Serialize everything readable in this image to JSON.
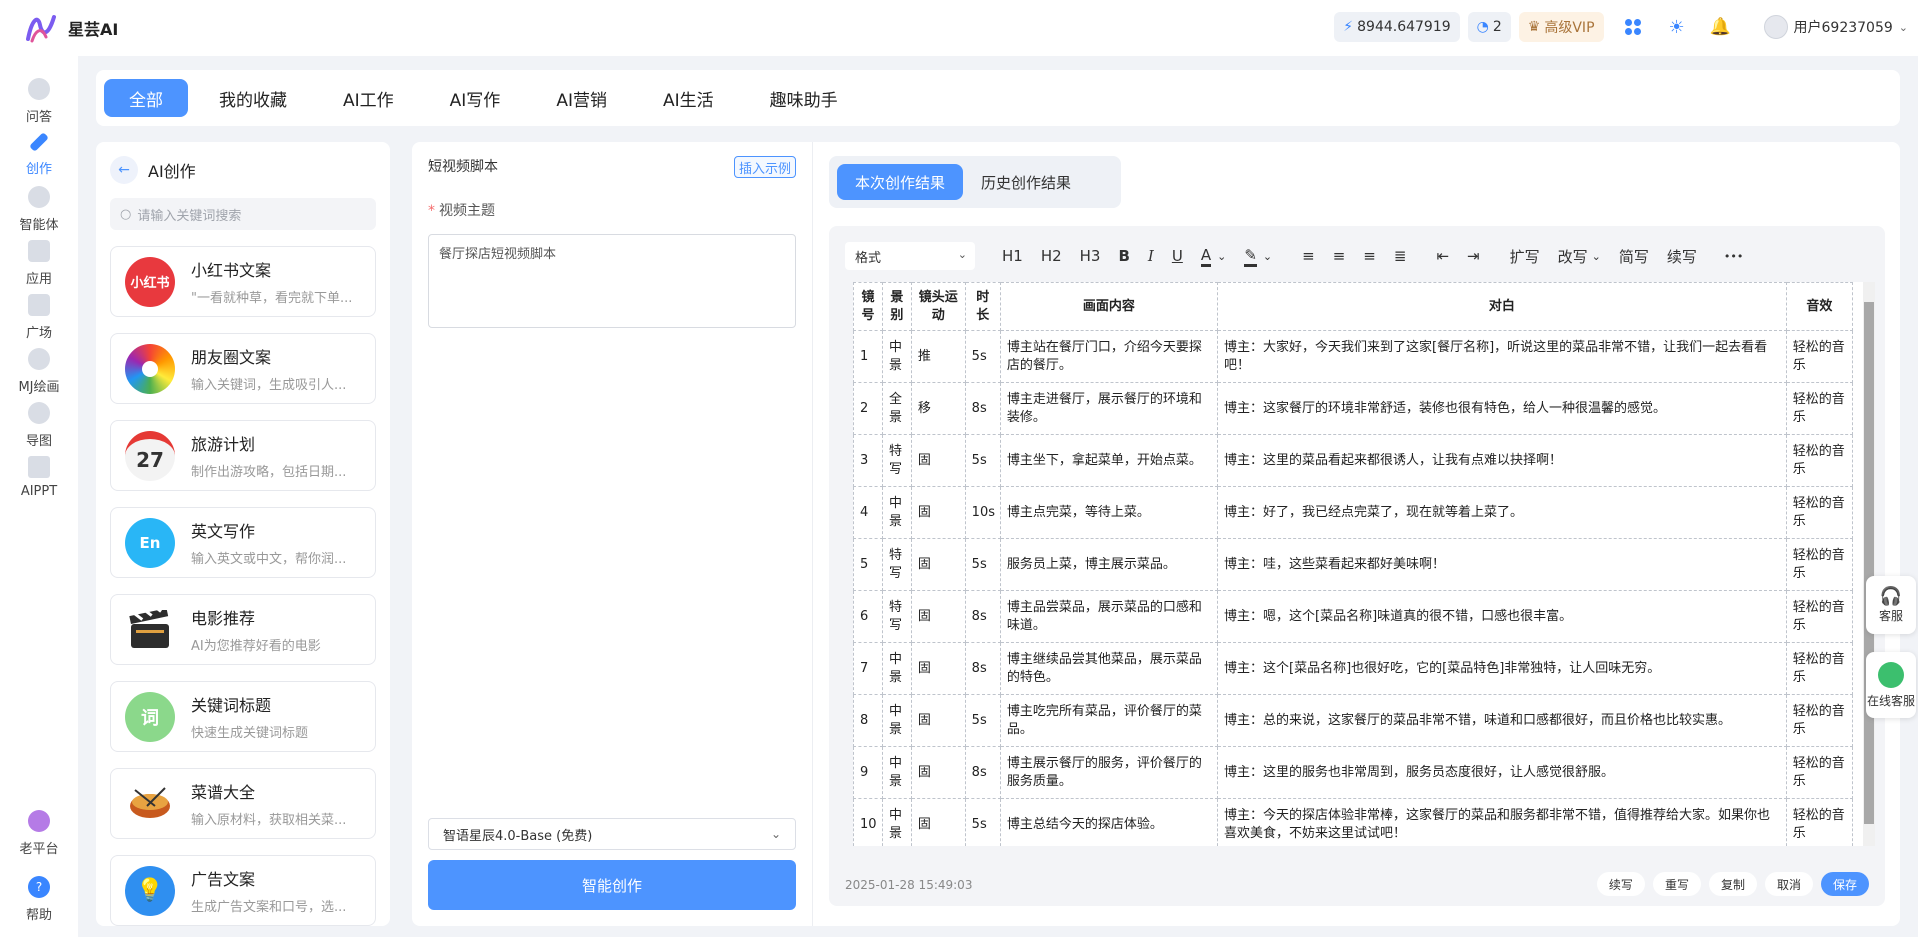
{
  "app": {
    "name": "星芸AI"
  },
  "topbar": {
    "balance": "8944.647919",
    "count": "2",
    "vip": "高级VIP",
    "username": "用户69237059"
  },
  "sidenav": {
    "items": [
      {
        "label": "问答"
      },
      {
        "label": "创作"
      },
      {
        "label": "智能体"
      },
      {
        "label": "应用"
      },
      {
        "label": "广场"
      },
      {
        "label": "MJ绘画"
      },
      {
        "label": "导图"
      },
      {
        "label": "AIPPT"
      },
      {
        "label": "老平台"
      },
      {
        "label": "帮助"
      }
    ]
  },
  "categories": [
    "全部",
    "我的收藏",
    "AI工作",
    "AI写作",
    "AI营销",
    "AI生活",
    "趣味助手"
  ],
  "left": {
    "title": "AI创作",
    "search_placeholder": "请输入关键词搜索",
    "cards": [
      {
        "title": "小红书文案",
        "desc": "\"一看就种草，看完就下单...",
        "icon": "xiaohongshu-icon",
        "icon_text": "小红书",
        "color": "#e8393e"
      },
      {
        "title": "朋友圈文案",
        "desc": "输入关键词，生成吸引人...",
        "icon": "aperture-icon",
        "icon_text": "",
        "color": "#f39b1e"
      },
      {
        "title": "旅游计划",
        "desc": "制作出游攻略，包括日期...",
        "icon": "calendar-icon",
        "icon_text": "27",
        "color": "#eeeeee"
      },
      {
        "title": "英文写作",
        "desc": "输入英文或中文，帮你润...",
        "icon": "en-icon",
        "icon_text": "En",
        "color": "#29b6f6"
      },
      {
        "title": "电影推荐",
        "desc": "AI为您推荐好看的电影",
        "icon": "clapperboard-icon",
        "icon_text": "",
        "color": "#333333"
      },
      {
        "title": "关键词标题",
        "desc": "快速生成关键词标题",
        "icon": "keyword-icon",
        "icon_text": "词",
        "color": "#6cc66c"
      },
      {
        "title": "菜谱大全",
        "desc": "输入原材料，获取相关菜...",
        "icon": "pot-icon",
        "icon_text": "",
        "color": "#d9822b"
      },
      {
        "title": "广告文案",
        "desc": "生成广告文案和口号，选...",
        "icon": "lightbulb-icon",
        "icon_text": "",
        "color": "#2f8ff0"
      }
    ]
  },
  "middle": {
    "title": "短视频脚本",
    "insert_label": "插入示例",
    "field_label": "视频主题",
    "field_value": "餐厅探店短视频脚本",
    "model": "智语星辰4.0-Base (免费)",
    "submit": "智能创作"
  },
  "right": {
    "tabs": [
      "本次创作结果",
      "历史创作结果"
    ],
    "toolbar": {
      "format": "格式",
      "h1": "H1",
      "h2": "H2",
      "h3": "H3",
      "bold": "B",
      "italic": "I",
      "underline": "U",
      "font_color": "A",
      "expand": "扩写",
      "rewrite": "改写",
      "simplify": "简写",
      "continue": "续写",
      "more": "•••"
    },
    "table": {
      "headers": [
        "镜号",
        "景别",
        "镜头运动",
        "时长",
        "画面内容",
        "对白",
        "音效"
      ],
      "rows": [
        [
          "1",
          "中景",
          "推",
          "5s",
          "博主站在餐厅门口，介绍今天要探店的餐厅。",
          "博主：大家好，今天我们来到了这家[餐厅名称]，听说这里的菜品非常不错，让我们一起去看看吧！",
          "轻松的音乐"
        ],
        [
          "2",
          "全景",
          "移",
          "8s",
          "博主走进餐厅，展示餐厅的环境和装修。",
          "博主：这家餐厅的环境非常舒适，装修也很有特色，给人一种很温馨的感觉。",
          "轻松的音乐"
        ],
        [
          "3",
          "特写",
          "固",
          "5s",
          "博主坐下，拿起菜单，开始点菜。",
          "博主：这里的菜品看起来都很诱人，让我有点难以抉择啊！",
          "轻松的音乐"
        ],
        [
          "4",
          "中景",
          "固",
          "10s",
          "博主点完菜，等待上菜。",
          "博主：好了，我已经点完菜了，现在就等着上菜了。",
          "轻松的音乐"
        ],
        [
          "5",
          "特写",
          "固",
          "5s",
          "服务员上菜，博主展示菜品。",
          "博主：哇，这些菜看起来都好美味啊！",
          "轻松的音乐"
        ],
        [
          "6",
          "特写",
          "固",
          "8s",
          "博主品尝菜品，展示菜品的口感和味道。",
          "博主：嗯，这个[菜品名称]味道真的很不错，口感也很丰富。",
          "轻松的音乐"
        ],
        [
          "7",
          "中景",
          "固",
          "8s",
          "博主继续品尝其他菜品，展示菜品的特色。",
          "博主：这个[菜品名称]也很好吃，它的[菜品特色]非常独特，让人回味无穷。",
          "轻松的音乐"
        ],
        [
          "8",
          "中景",
          "固",
          "5s",
          "博主吃完所有菜品，评价餐厅的菜品。",
          "博主：总的来说，这家餐厅的菜品非常不错，味道和口感都很好，而且价格也比较实惠。",
          "轻松的音乐"
        ],
        [
          "9",
          "中景",
          "固",
          "8s",
          "博主展示餐厅的服务，评价餐厅的服务质量。",
          "博主：这里的服务也非常周到，服务员态度很好，让人感觉很舒服。",
          "轻松的音乐"
        ],
        [
          "10",
          "中景",
          "固",
          "5s",
          "博主总结今天的探店体验。",
          "博主：今天的探店体验非常棒，这家餐厅的菜品和服务都非常不错，值得推荐给大家。如果你也喜欢美食，不妨来这里试试吧！",
          "轻松的音乐"
        ]
      ]
    },
    "timestamp": "2025-01-28 15:49:03",
    "actions": [
      "续写",
      "重写",
      "复制",
      "取消",
      "保存"
    ]
  },
  "floating": {
    "service": "客服",
    "online": "在线客服"
  },
  "colors": {
    "accent": "#4d94ff"
  }
}
